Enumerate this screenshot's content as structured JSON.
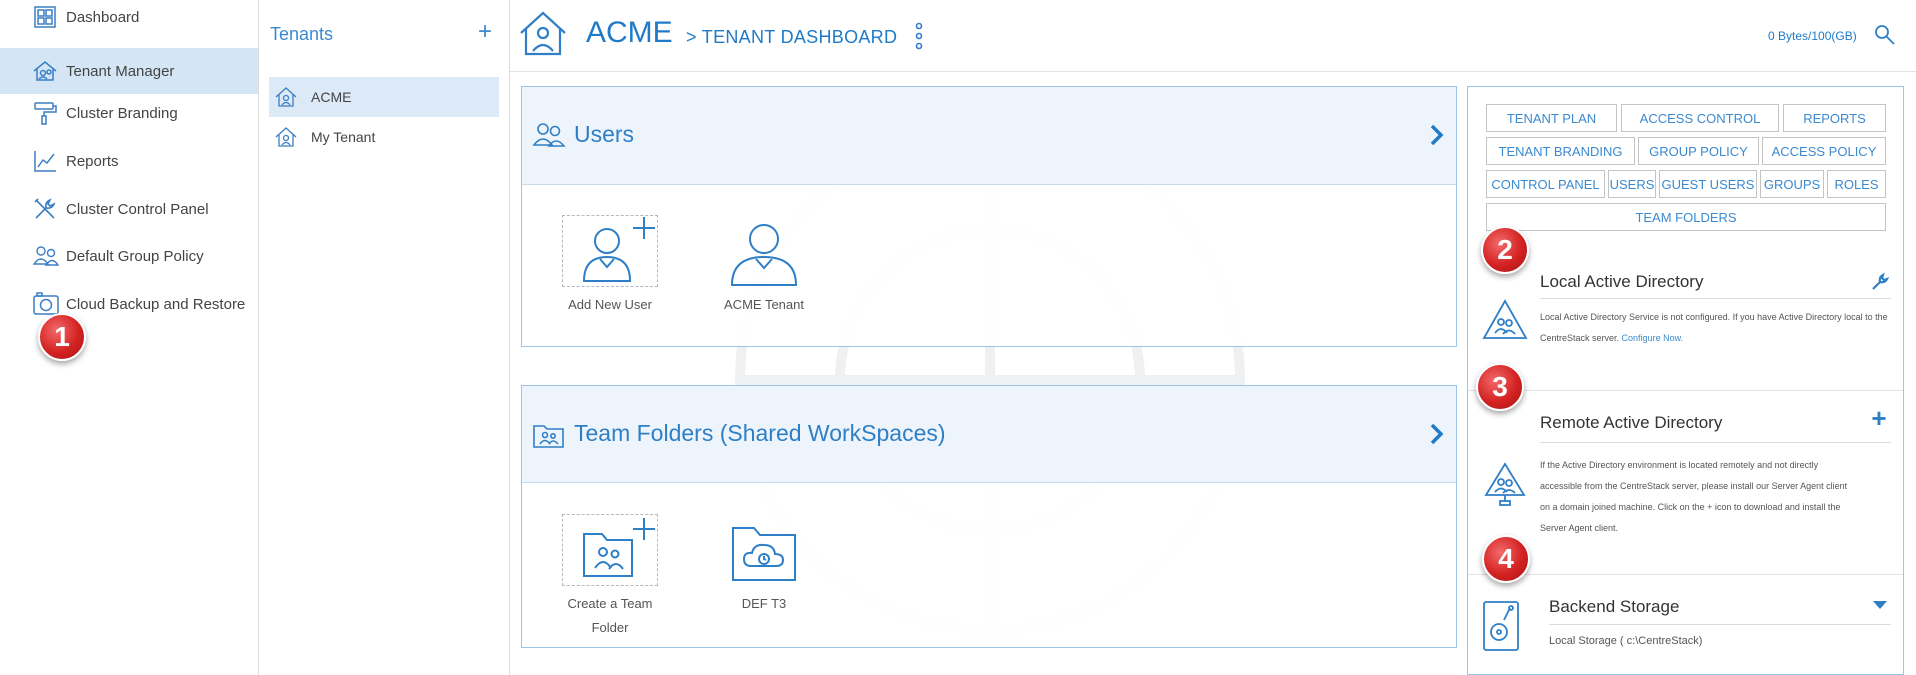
{
  "nav": {
    "items": [
      {
        "label": "Dashboard",
        "icon": "dashboard-icon"
      },
      {
        "label": "Tenant Manager",
        "icon": "tenant-manager-icon"
      },
      {
        "label": "Cluster Branding",
        "icon": "paint-roller-icon"
      },
      {
        "label": "Reports",
        "icon": "chart-line-icon"
      },
      {
        "label": "Cluster Control Panel",
        "icon": "tools-icon"
      },
      {
        "label": "Default Group Policy",
        "icon": "group-icon"
      },
      {
        "label": "Cloud Backup and Restore",
        "icon": "camera-icon"
      }
    ],
    "active_index": 1
  },
  "badges": [
    "1",
    "2",
    "3",
    "4"
  ],
  "tenants": {
    "title": "Tenants",
    "add_symbol": "+",
    "items": [
      {
        "label": "ACME",
        "active": true
      },
      {
        "label": "My Tenant",
        "active": false
      }
    ]
  },
  "header": {
    "title": "ACME",
    "breadcrumb": "> TENANT DASHBOARD",
    "storage": "0 Bytes/100(GB)"
  },
  "users_card": {
    "title": "Users",
    "tiles": [
      {
        "label": "Add New User",
        "icon": "add-user-icon"
      },
      {
        "label": "ACME Tenant",
        "icon": "user-icon"
      }
    ]
  },
  "team_folders_card": {
    "title": "Team Folders (Shared WorkSpaces)",
    "tiles": [
      {
        "label": "Create a Team Folder",
        "icon": "add-team-folder-icon"
      },
      {
        "label": "DEF T3",
        "icon": "cloud-folder-icon"
      }
    ]
  },
  "right_panel": {
    "tabs": [
      [
        "TENANT PLAN",
        "ACCESS CONTROL",
        "REPORTS"
      ],
      [
        "TENANT BRANDING",
        "GROUP POLICY",
        "ACCESS POLICY"
      ],
      [
        "CONTROL PANEL",
        "USERS",
        "GUEST USERS",
        "GROUPS",
        "ROLES"
      ],
      [
        "TEAM FOLDERS"
      ]
    ],
    "local_ad": {
      "title": "Local Active Directory",
      "text": "Local Active Directory Service is not configured. If you have Active Directory local to the CentreStack server.",
      "link": "Configure Now."
    },
    "remote_ad": {
      "title": "Remote Active Directory",
      "lines": [
        "If the Active Directory environment is located remotely and not directly",
        "accessible from the CentreStack server, please install our Server Agent client",
        "on a domain joined machine. Click on the + icon to download and install the",
        "Server Agent client."
      ]
    },
    "backend_storage": {
      "title": "Backend Storage",
      "value": "Local Storage ( c:\\CentreStack)"
    }
  },
  "colors": {
    "accent": "#1f7bc8",
    "nav_active": "#d4e6f6",
    "badge": "#d42222"
  }
}
